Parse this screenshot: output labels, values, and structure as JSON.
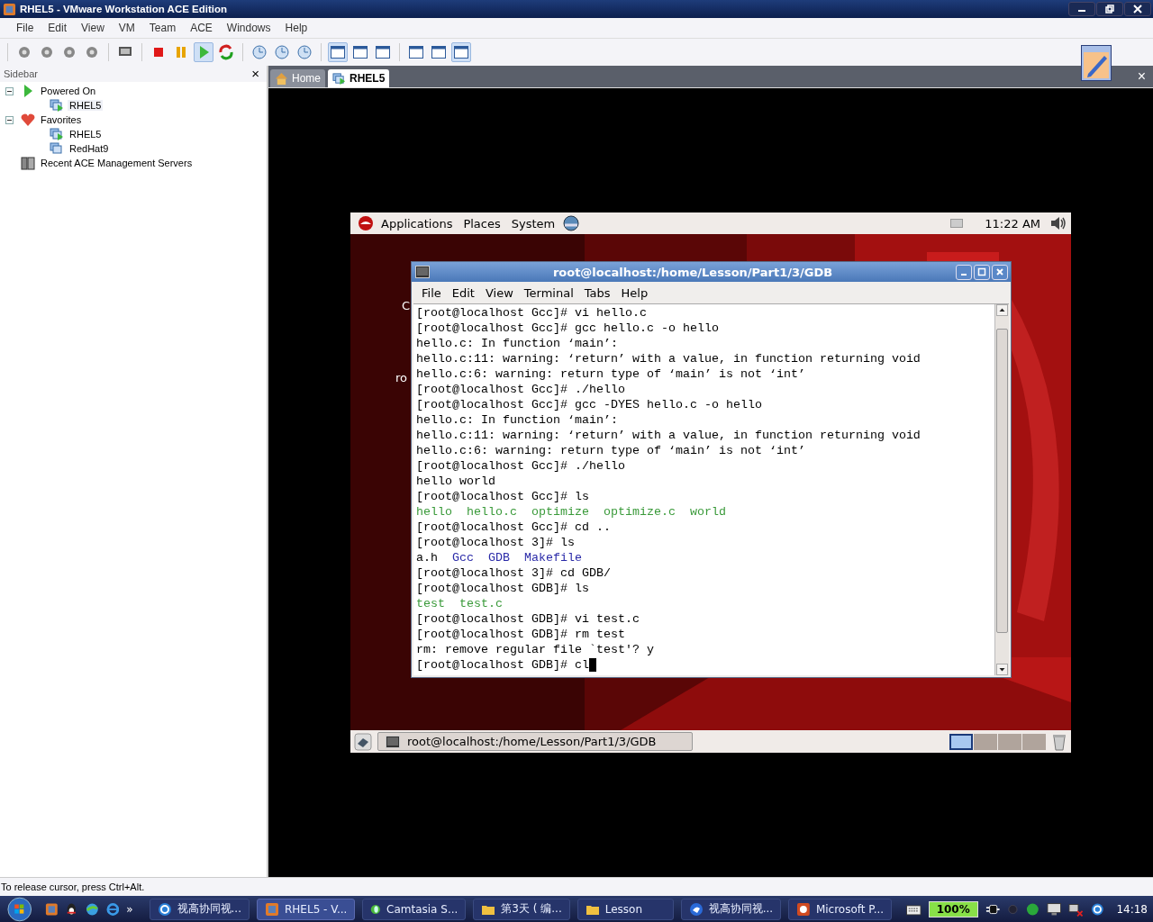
{
  "window": {
    "title": "RHEL5 - VMware Workstation ACE Edition"
  },
  "menu": [
    "File",
    "Edit",
    "View",
    "VM",
    "Team",
    "ACE",
    "Windows",
    "Help"
  ],
  "toolbar": [
    [
      {
        "kind": "gear",
        "pressed": false
      },
      {
        "kind": "gear",
        "pressed": false
      },
      {
        "kind": "gear",
        "pressed": false
      },
      {
        "kind": "gear",
        "pressed": false
      }
    ],
    [
      {
        "kind": "monitor",
        "pressed": false
      }
    ],
    [
      {
        "kind": "stop",
        "pressed": false
      },
      {
        "kind": "pause",
        "pressed": false
      },
      {
        "kind": "play",
        "pressed": true
      },
      {
        "kind": "refresh",
        "pressed": false
      }
    ],
    [
      {
        "kind": "clock",
        "pressed": false
      },
      {
        "kind": "clock",
        "pressed": false
      },
      {
        "kind": "clock",
        "pressed": false
      }
    ],
    [
      {
        "kind": "window",
        "pressed": true
      },
      {
        "kind": "window",
        "pressed": false
      },
      {
        "kind": "window",
        "pressed": false
      }
    ],
    [
      {
        "kind": "window",
        "pressed": false
      },
      {
        "kind": "window",
        "pressed": false
      },
      {
        "kind": "window",
        "pressed": true
      }
    ]
  ],
  "sidebar": {
    "title": "Sidebar",
    "close": "×",
    "items": [
      {
        "label": "Powered On",
        "kind": "play",
        "expanded": true,
        "selected": false,
        "children": [
          {
            "label": "RHEL5",
            "kind": "vm-running",
            "selected": true
          }
        ]
      },
      {
        "label": "Favorites",
        "kind": "heart",
        "expanded": true,
        "selected": false,
        "children": [
          {
            "label": "RHEL5",
            "kind": "vm-running",
            "selected": false
          },
          {
            "label": "RedHat9",
            "kind": "vm",
            "selected": false
          }
        ]
      },
      {
        "label": "Recent ACE Management Servers",
        "kind": "servers",
        "selected": false
      }
    ]
  },
  "tabs": [
    {
      "label": "Home",
      "kind": "house",
      "selected": false
    },
    {
      "label": "RHEL5",
      "kind": "vm-running",
      "selected": true
    }
  ],
  "tab_close": "×",
  "guest": {
    "top_panel": {
      "menus": [
        "Applications",
        "Places",
        "System"
      ],
      "clock": "11:22 AM"
    },
    "desktop_labels": [
      "C",
      "ro"
    ],
    "terminal": {
      "title": "root@localhost:/home/Lesson/Part1/3/GDB",
      "menu": [
        "File",
        "Edit",
        "View",
        "Terminal",
        "Tabs",
        "Help"
      ],
      "lines": [
        [
          {
            "text": "[root@localhost Gcc]# vi hello.c",
            "color": "#000000"
          }
        ],
        [
          {
            "text": "[root@localhost Gcc]# gcc hello.c -o hello",
            "color": "#000000"
          }
        ],
        [
          {
            "text": "hello.c: In function ‘main’:",
            "color": "#000000"
          }
        ],
        [
          {
            "text": "hello.c:11: warning: ‘return’ with a value, in function returning void",
            "color": "#000000"
          }
        ],
        [
          {
            "text": "hello.c:6: warning: return type of ‘main’ is not ‘int’",
            "color": "#000000"
          }
        ],
        [
          {
            "text": "[root@localhost Gcc]# ./hello",
            "color": "#000000"
          }
        ],
        [
          {
            "text": "[root@localhost Gcc]# gcc -DYES hello.c -o hello",
            "color": "#000000"
          }
        ],
        [
          {
            "text": "hello.c: In function ‘main’:",
            "color": "#000000"
          }
        ],
        [
          {
            "text": "hello.c:11: warning: ‘return’ with a value, in function returning void",
            "color": "#000000"
          }
        ],
        [
          {
            "text": "hello.c:6: warning: return type of ‘main’ is not ‘int’",
            "color": "#000000"
          }
        ],
        [
          {
            "text": "[root@localhost Gcc]# ./hello",
            "color": "#000000"
          }
        ],
        [
          {
            "text": "hello world",
            "color": "#000000"
          }
        ],
        [
          {
            "text": "[root@localhost Gcc]# ls",
            "color": "#000000"
          }
        ],
        [
          {
            "text": "hello",
            "color": "#3a9a3a"
          },
          {
            "text": "hello.c",
            "color": "#3a9a3a"
          },
          {
            "text": "optimize",
            "color": "#3a9a3a"
          },
          {
            "text": "optimize.c",
            "color": "#3a9a3a"
          },
          {
            "text": "world",
            "color": "#3a9a3a"
          }
        ],
        [
          {
            "text": "[root@localhost Gcc]# cd ..",
            "color": "#000000"
          }
        ],
        [
          {
            "text": "[root@localhost 3]# ls",
            "color": "#000000"
          }
        ],
        [
          {
            "text": "a.h",
            "color": "#000000"
          },
          {
            "text": "Gcc",
            "color": "#2a2aa8"
          },
          {
            "text": "GDB",
            "color": "#2a2aa8"
          },
          {
            "text": "Makefile",
            "color": "#2a2aa8"
          }
        ],
        [
          {
            "text": "[root@localhost 3]# cd GDB/",
            "color": "#000000"
          }
        ],
        [
          {
            "text": "[root@localhost GDB]# ls",
            "color": "#000000"
          }
        ],
        [
          {
            "text": "test",
            "color": "#3a9a3a"
          },
          {
            "text": "test.c",
            "color": "#3a9a3a"
          }
        ],
        [
          {
            "text": "[root@localhost GDB]# vi test.c",
            "color": "#000000"
          }
        ],
        [
          {
            "text": "[root@localhost GDB]# rm test",
            "color": "#000000"
          }
        ],
        [
          {
            "text": "rm: remove regular file `test'? y",
            "color": "#000000"
          }
        ],
        [
          {
            "text": "[root@localhost GDB]# cl",
            "color": "#000000"
          }
        ]
      ]
    },
    "bottom_panel": {
      "task": "root@localhost:/home/Lesson/Part1/3/GDB",
      "workspaces": [
        {
          "selected": true
        },
        {
          "selected": false
        },
        {
          "selected": false
        },
        {
          "selected": false
        }
      ]
    }
  },
  "status_bar": "To release cursor, press Ctrl+Alt.",
  "taskbar": {
    "quick_more": "»",
    "tasks": [
      {
        "label": "视高协同视...",
        "kind": "s-logo",
        "selected": false
      },
      {
        "label": "RHEL5 - V...",
        "kind": "vm",
        "selected": true
      },
      {
        "label": "Camtasia S...",
        "kind": "ball",
        "selected": false
      },
      {
        "label": "第3天 ( 编...",
        "kind": "folder",
        "selected": false
      },
      {
        "label": "Lesson",
        "kind": "folder",
        "selected": false
      },
      {
        "label": "视高协同视...",
        "kind": "bird",
        "selected": false
      },
      {
        "label": "Microsoft P...",
        "kind": "slide",
        "selected": false
      }
    ],
    "battery": "100%",
    "clock": "14:18"
  }
}
